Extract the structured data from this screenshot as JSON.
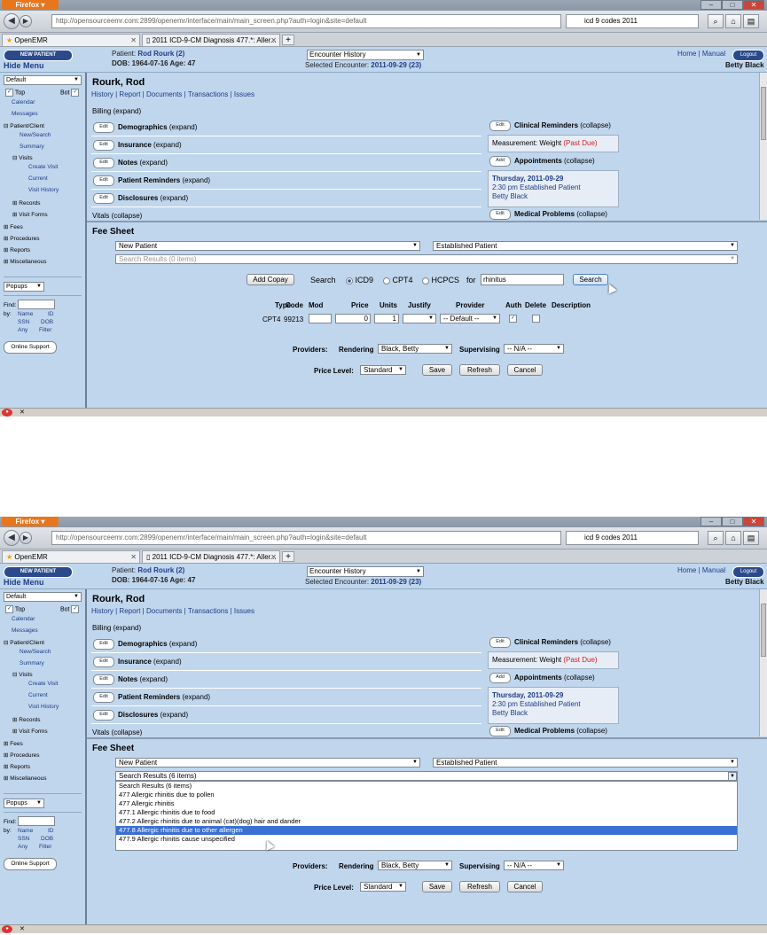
{
  "browser": {
    "menu_button": "Firefox ▾",
    "url": "http://opensourceemr.com:2899/openemr/interface/main/main_screen.php?auth=login&site=default",
    "search_query": "icd 9 codes 2011",
    "tabs": [
      {
        "label": "OpenEMR"
      },
      {
        "label": "2011 ICD-9-CM Diagnosis 477.*: Aller..."
      }
    ]
  },
  "header": {
    "new_patient": "NEW PATIENT",
    "hide_menu": "Hide Menu",
    "patient_prefix": "Patient:",
    "patient_name": "Rod Rourk (2)",
    "dob_line": "DOB: 1964-07-16 Age: 47",
    "encounter_history": "Encounter History",
    "selected_encounter_prefix": "Selected Encounter:",
    "selected_encounter": "2011-09-29 (23)",
    "home": "Home",
    "manual": "Manual",
    "logout": "Logout",
    "user": "Betty Black"
  },
  "leftnav": {
    "view_select": "Default",
    "top": "Top",
    "bot": "Bot",
    "items": [
      {
        "label": "Calendar"
      },
      {
        "label": "Messages"
      },
      {
        "label": "Patient/Client"
      },
      {
        "label": "New/Search"
      },
      {
        "label": "Summary"
      },
      {
        "label": "Visits"
      },
      {
        "label": "Create Visit"
      },
      {
        "label": "Current"
      },
      {
        "label": "Visit History"
      },
      {
        "label": "Records"
      },
      {
        "label": "Visit Forms"
      },
      {
        "label": "Fees"
      },
      {
        "label": "Procedures"
      },
      {
        "label": "Reports"
      },
      {
        "label": "Miscellaneous"
      }
    ],
    "popups": "Popups",
    "find": "Find:",
    "by": "by:",
    "find_options": [
      "Name",
      "ID",
      "SSN",
      "DOB",
      "Any",
      "Filter"
    ],
    "online_support": "Online Support"
  },
  "summary": {
    "patient_title": "Rourk, Rod",
    "tab_links": [
      "History",
      "Report",
      "Documents",
      "Transactions",
      "Issues"
    ],
    "billing": "Billing (expand)",
    "edit": "Edit",
    "add": "Add",
    "sections": [
      {
        "title": "Demographics",
        "state": "(expand)"
      },
      {
        "title": "Insurance",
        "state": "(expand)"
      },
      {
        "title": "Notes",
        "state": "(expand)"
      },
      {
        "title": "Patient Reminders",
        "state": "(expand)"
      },
      {
        "title": "Disclosures",
        "state": "(expand)"
      }
    ],
    "vitals": "Vitals (collapse)",
    "clinical_reminders_title": "Clinical Reminders",
    "clinical_reminders_state": "(collapse)",
    "reminder_text": "Measurement: Weight",
    "reminder_status": "(Past Due)",
    "appointments_title": "Appointments",
    "appointments_state": "(collapse)",
    "appt_date": "Thursday, 2011-09-29",
    "appt_desc": "2:30 pm Established Patient",
    "appt_provider": "Betty Black",
    "medical_problems_title": "Medical Problems",
    "medical_problems_state": "(collapse)"
  },
  "fee_sheet": {
    "title": "Fee Sheet",
    "category_left": "New Patient",
    "category_right": "Established Patient",
    "search_results": "Search Results (0 items)",
    "search_results_6": "Search Results (6 items)",
    "add_copay": "Add Copay",
    "search_label": "Search",
    "code_types": [
      "ICD9",
      "CPT4",
      "HCPCS"
    ],
    "for": "for",
    "search_term": "rhinitus",
    "search_button": "Search",
    "columns": [
      "Type",
      "Code",
      "Mod",
      "Price",
      "Units",
      "Justify",
      "Provider",
      "Auth",
      "Delete",
      "Description"
    ],
    "row": {
      "type": "CPT4",
      "code": "99213",
      "mod": "",
      "price": "0",
      "units": "1",
      "provider": "-- Default --"
    },
    "providers_label": "Providers:",
    "rendering_label": "Rendering",
    "rendering_value": "Black, Betty",
    "supervising_label": "Supervising",
    "supervising_value": "-- N/A --",
    "price_level_label": "Price Level:",
    "price_level_value": "Standard",
    "save": "Save",
    "refresh": "Refresh",
    "cancel": "Cancel",
    "dropdown_options": [
      {
        "label": "Search Results (6 items)"
      },
      {
        "label": "477 Allergic rhinitis due to pollen"
      },
      {
        "label": "477 Allergic rhinitis"
      },
      {
        "label": "477.1 Allergic rhinitis due to food"
      },
      {
        "label": "477.2 Allergic rhinitis due to animal (cat)(dog) hair and dander"
      },
      {
        "label": "477.8 Allergic rhinitis due to other allergen"
      },
      {
        "label": "477.9 Allergic rhinitis cause unspecified"
      }
    ]
  }
}
